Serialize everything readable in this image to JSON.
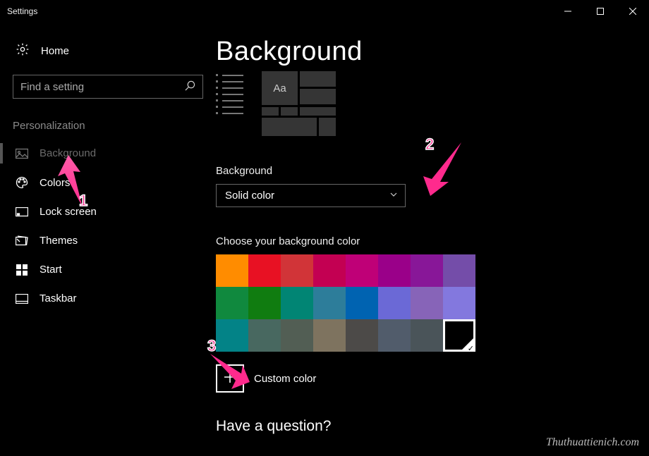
{
  "window": {
    "title": "Settings"
  },
  "sidebar": {
    "home": "Home",
    "search_placeholder": "Find a setting",
    "category": "Personalization",
    "items": [
      {
        "label": "Background"
      },
      {
        "label": "Colors"
      },
      {
        "label": "Lock screen"
      },
      {
        "label": "Themes"
      },
      {
        "label": "Start"
      },
      {
        "label": "Taskbar"
      }
    ]
  },
  "main": {
    "title": "Background",
    "preview_sample": "Aa",
    "bg_label": "Background",
    "bg_value": "Solid color",
    "choose_label": "Choose your background color",
    "colors_row1": [
      "#ff8c00",
      "#e81123",
      "#d13438",
      "#c30052",
      "#bf0077",
      "#9a0089",
      "#881798",
      "#744da9"
    ],
    "colors_row2": [
      "#10893e",
      "#107c10",
      "#018574",
      "#2d7d9a",
      "#0063b1",
      "#6b69d6",
      "#8764b8",
      "#8378de"
    ],
    "colors_row3": [
      "#038387",
      "#486860",
      "#525e54",
      "#7e735f",
      "#4c4a48",
      "#515c6b",
      "#4a5459",
      "#000000"
    ],
    "selected_color_index": 23,
    "custom_label": "Custom color",
    "question": "Have a question?"
  },
  "annotations": {
    "a1": "1",
    "a2": "2",
    "a3": "3"
  },
  "watermark": "Thuthuattienich.com"
}
